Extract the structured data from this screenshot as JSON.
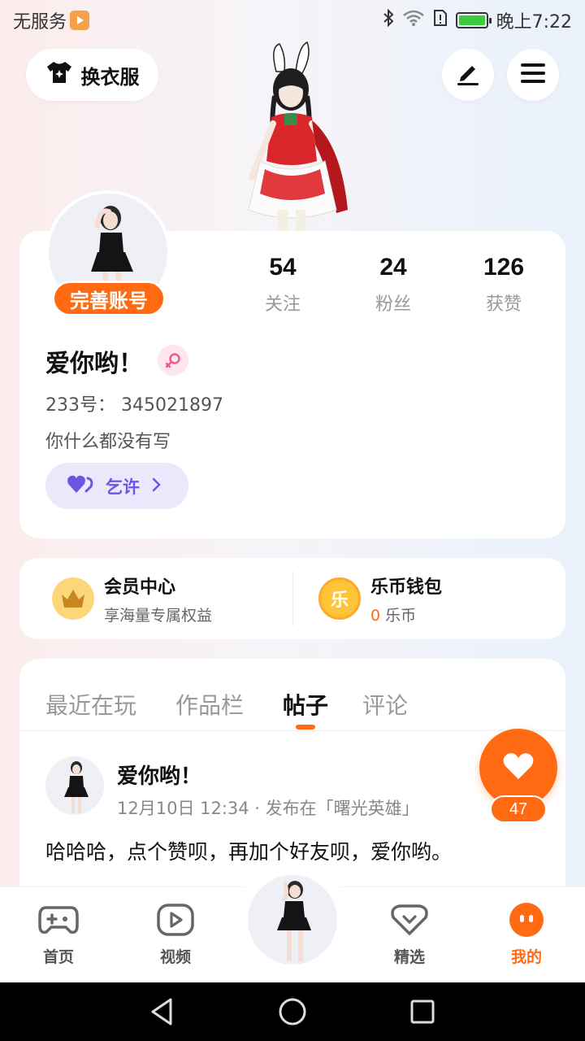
{
  "status_bar": {
    "carrier": "无服务",
    "time": "晚上7:22"
  },
  "header": {
    "outfit_label": "换衣服"
  },
  "profile": {
    "complete_label": "完善账号",
    "stats": [
      {
        "value": "54",
        "label": "关注"
      },
      {
        "value": "24",
        "label": "粉丝"
      },
      {
        "value": "126",
        "label": "获赞"
      }
    ],
    "nickname": "爱你哟！",
    "account_id": "233号： 345021897",
    "bio": "你什么都没有写",
    "tag_label": "乞许"
  },
  "member": {
    "vip": {
      "title": "会员中心",
      "subtitle": "享海量专属权益",
      "icon_char": ""
    },
    "wallet": {
      "title": "乐币钱包",
      "amount": "0",
      "unit": "乐币",
      "icon_char": "乐"
    }
  },
  "tabs": [
    {
      "label": "最近在玩"
    },
    {
      "label": "作品栏"
    },
    {
      "label": "帖子"
    },
    {
      "label": "评论"
    }
  ],
  "post": {
    "author": "爱你哟！",
    "meta": "12月10日 12:34 · 发布在「曙光英雄」",
    "text": "哈哈哈，点个赞呗，再加个好友呗，爱你哟。",
    "like_count": "47"
  },
  "bottom_nav": [
    {
      "label": "首页"
    },
    {
      "label": "视频"
    },
    {
      "label": "精选"
    },
    {
      "label": "我的"
    }
  ],
  "colors": {
    "accent": "#ff6a13",
    "purple": "#6a57e0"
  }
}
